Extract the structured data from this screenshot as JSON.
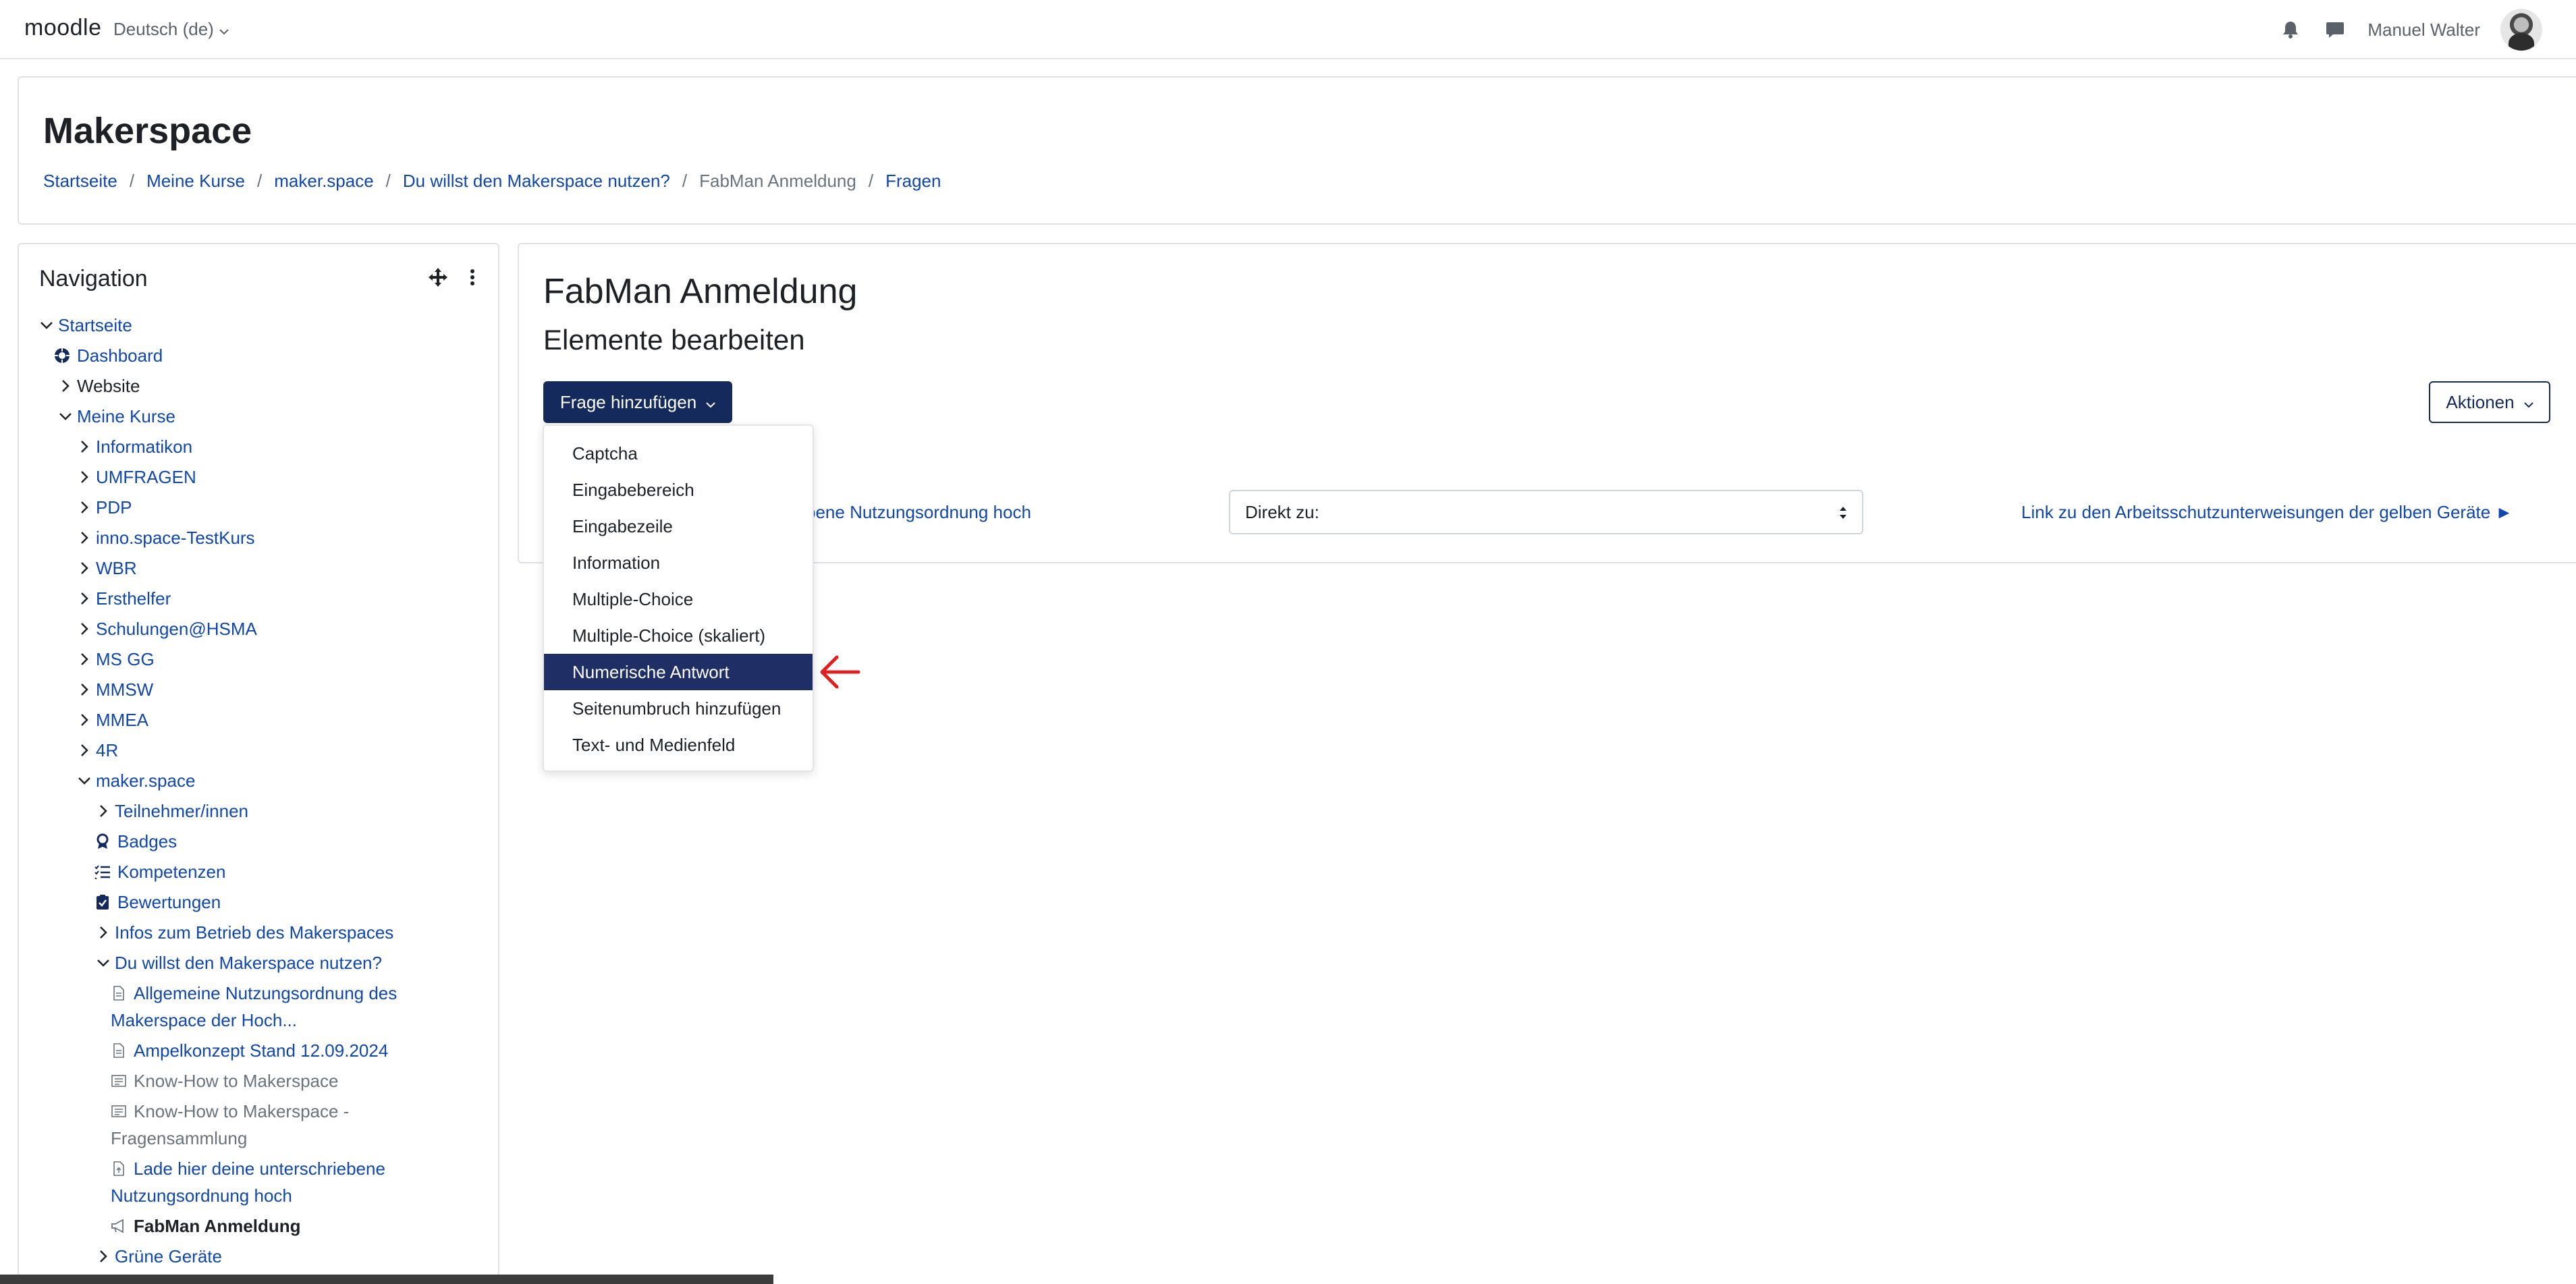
{
  "navbar": {
    "brand": "moodle",
    "language": "Deutsch (de)",
    "user_name": "Manuel Walter",
    "icons": [
      "bell-icon",
      "chat-icon",
      "chevron-down-icon"
    ]
  },
  "header": {
    "title": "Makerspace",
    "breadcrumb": [
      "Startseite",
      "Meine Kurse",
      "maker.space",
      "Du willst den Makerspace nutzen?",
      "FabMan Anmeldung",
      "Fragen"
    ]
  },
  "navigation": {
    "title": "Navigation",
    "items": [
      "Startseite",
      "Dashboard",
      "Website",
      "Meine Kurse",
      "Informatikon",
      "UMFRAGEN",
      "PDP",
      "inno.space-TestKurs",
      "WBR",
      "Ersthelfer",
      "Schulungen@HSMA",
      "MS GG",
      "MMSW",
      "MMEA",
      "4R",
      "maker.space",
      "Teilnehmer/innen",
      "Badges",
      "Kompetenzen",
      "Bewertungen",
      "Infos zum Betrieb des Makerspaces",
      "Du willst den Makerspace nutzen?",
      "Allgemeine Nutzungsordnung des",
      "Makerspace der Hoch...",
      "Ampelkonzept Stand 12.09.2024",
      "Know-How to Makerspace",
      "Know-How to Makerspace -",
      "Fragensammlung",
      "Lade hier deine unterschriebene",
      "Nutzungsordnung hoch",
      "FabMan Anmeldung",
      "Grüne Geräte"
    ]
  },
  "main": {
    "course_title": "FabMan Anmeldung",
    "subtitle": "Elemente bearbeiten",
    "add_question_button": "Frage hinzufügen",
    "actions_button": "Aktionen",
    "prev_link": "bene Nutzungsordnung hoch",
    "jump_select": "Direkt zu:",
    "next_link": "Link zu den Arbeitsschutzunterweisungen der gelben Geräte ►"
  },
  "dropdown": {
    "items": [
      "Captcha",
      "Eingabebereich",
      "Eingabezeile",
      "Information",
      "Multiple-Choice",
      "Multiple-Choice (skaliert)",
      "Numerische Antwort",
      "Seitenumbruch hinzufügen",
      "Text- und Medienfeld"
    ],
    "active_index": 6
  },
  "colors": {
    "primary": "#142a5c",
    "link": "#0f47ad",
    "active_item": "#1f2f66",
    "annotation_arrow": "#e02020"
  }
}
